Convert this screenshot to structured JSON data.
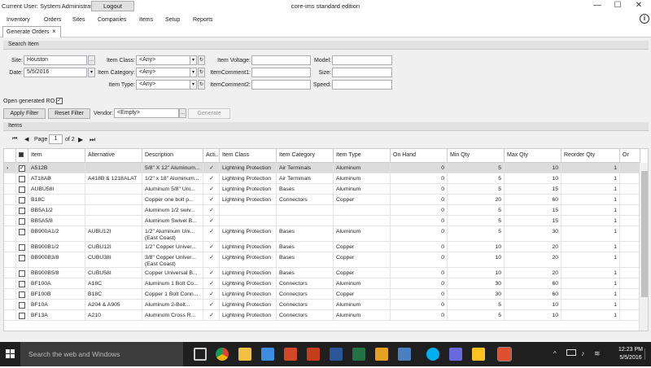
{
  "app": {
    "current_user": "Current User: System Administrator",
    "logout_label": "Logout",
    "title": "core-ims standard edition",
    "minimize": "—",
    "maximize": "☐",
    "close": "✕"
  },
  "menu": [
    "Inventory",
    "Orders",
    "Sites",
    "Companies",
    "Items",
    "Setup",
    "Reports"
  ],
  "info_icon": "i",
  "tab": {
    "label": "Generate Orders",
    "close": "×"
  },
  "search": {
    "header": "Search Item",
    "site_label": "Site:",
    "site_value": "Houston",
    "date_label": "Date:",
    "date_value": "5/5/2016",
    "item_class_label": "Item Class:",
    "item_class_value": "<Any>",
    "item_category_label": "Item Category:",
    "item_category_value": "<Any>",
    "item_type_label": "Item Type:",
    "item_type_value": "<Any>",
    "item_voltage_label": "Item Voltage:",
    "item_comment1_label": "ItemComment1:",
    "item_comment2_label": "ItemComment2:",
    "model_label": "Model:",
    "size_label": "Size:",
    "speed_label": "Speed:",
    "browse_glyph": "...",
    "date_glyph": "▾",
    "dd_glyph": "▾",
    "refresh_glyph": "↻"
  },
  "open_ro": {
    "label": "Open generated RO:",
    "checked": "✓"
  },
  "actions": {
    "apply_filter": "Apply Filter",
    "reset_filter": "Reset Filter",
    "vendor_label": "Vendor:",
    "vendor_value": "<Empty>",
    "generate": "Generate"
  },
  "items": {
    "header": "Items",
    "page_label": "Page",
    "page_value": "1",
    "page_of": "of 2",
    "first_glyph": "⏮",
    "prev_glyph": "◀",
    "next_glyph": "▶",
    "last_glyph": "⏭"
  },
  "table": {
    "columns": [
      "",
      "Item",
      "Alternative",
      "Description",
      "Acti...",
      "Item Class",
      "Item Category",
      "Item Type",
      "On Hand",
      "Min Qty",
      "Max Qty",
      "Reorder Qty",
      "Or"
    ],
    "rows": [
      {
        "check": "✓",
        "item": "A512B",
        "alt": "",
        "desc": "5/8\" X 12\" Aluminum...",
        "active": "✓",
        "class": "Lightning Protection",
        "category": "Air Terminals",
        "type": "Aluminum",
        "on_hand": "0",
        "min": "5",
        "max": "10",
        "reorder": "1"
      },
      {
        "check": "",
        "item": "AT18AB",
        "alt": "A418B & 1218ALAT",
        "desc": "1/2\" x 18\" Aluminum...",
        "active": "✓",
        "class": "Lightning Protection",
        "category": "Air Terminals",
        "type": "Aluminum",
        "on_hand": "0",
        "min": "5",
        "max": "10",
        "reorder": "1"
      },
      {
        "check": "",
        "item": "AUBU58I",
        "alt": "",
        "desc": "Aluminum 5/8\" Uni...",
        "active": "✓",
        "class": "Lightning Protection",
        "category": "Bases",
        "type": "Aluminum",
        "on_hand": "0",
        "min": "5",
        "max": "15",
        "reorder": "1"
      },
      {
        "check": "",
        "item": "B18C",
        "alt": "",
        "desc": "Copper one bolt p...",
        "active": "✓",
        "class": "Lightning Protection",
        "category": "Connectors",
        "type": "Copper",
        "on_hand": "0",
        "min": "20",
        "max": "60",
        "reorder": "1"
      },
      {
        "check": "",
        "item": "BB5A1/2",
        "alt": "",
        "desc": "Aluminum 1/2 swiv...",
        "active": "✓",
        "class": "",
        "category": "",
        "type": "",
        "on_hand": "0",
        "min": "5",
        "max": "15",
        "reorder": "1"
      },
      {
        "check": "",
        "item": "BB5A5/8",
        "alt": "",
        "desc": "Aluminum Swivel B...",
        "active": "✓",
        "class": "",
        "category": "",
        "type": "",
        "on_hand": "0",
        "min": "5",
        "max": "15",
        "reorder": "1"
      },
      {
        "check": "",
        "item": "BB900A1/2",
        "alt": "AUBU12I",
        "desc": "1/2\" Aluminum Uni... (East Coast)",
        "active": "✓",
        "class": "Lightning Protection",
        "category": "Bases",
        "type": "Aluminum",
        "on_hand": "0",
        "min": "5",
        "max": "30",
        "reorder": "1"
      },
      {
        "check": "",
        "item": "BB900B1/2",
        "alt": "CUBU12I",
        "desc": "1/2\" Copper Univer...",
        "active": "✓",
        "class": "Lightning Protection",
        "category": "Bases",
        "type": "Copper",
        "on_hand": "0",
        "min": "10",
        "max": "20",
        "reorder": "1"
      },
      {
        "check": "",
        "item": "BB900B3/8",
        "alt": "CUBU38I",
        "desc": "3/8\" Copper Univer... (East Coast)",
        "active": "✓",
        "class": "Lightning Protection",
        "category": "Bases",
        "type": "Copper",
        "on_hand": "0",
        "min": "10",
        "max": "20",
        "reorder": "1"
      },
      {
        "check": "",
        "item": "BB900B5/8",
        "alt": "CUBU58I",
        "desc": "Copper Universal B...",
        "active": "✓",
        "class": "Lightning Protection",
        "category": "Bases",
        "type": "Copper",
        "on_hand": "0",
        "min": "10",
        "max": "20",
        "reorder": "1"
      },
      {
        "check": "",
        "item": "BF100A",
        "alt": "A18C",
        "desc": "Aluminum 1 Bolt Co...",
        "active": "✓",
        "class": "Lightning Protection",
        "category": "Connectors",
        "type": "Aluminum",
        "on_hand": "0",
        "min": "30",
        "max": "60",
        "reorder": "1"
      },
      {
        "check": "",
        "item": "BF100B",
        "alt": "B18C",
        "desc": "Copper 1 Bolt Conn...",
        "active": "✓",
        "class": "Lightning Protection",
        "category": "Connectors",
        "type": "Copper",
        "on_hand": "0",
        "min": "30",
        "max": "60",
        "reorder": "1"
      },
      {
        "check": "",
        "item": "BF10A",
        "alt": "A204 & A905",
        "desc": "Aluminum 2-Bolt...",
        "active": "✓",
        "class": "Lightning Protection",
        "category": "Connectors",
        "type": "Aluminum",
        "on_hand": "0",
        "min": "5",
        "max": "10",
        "reorder": "1"
      },
      {
        "check": "",
        "item": "BF13A",
        "alt": "A210",
        "desc": "Aluminum Cross R...",
        "active": "✓",
        "class": "Lightning Protection",
        "category": "Connectors",
        "type": "Aluminum",
        "on_hand": "0",
        "min": "5",
        "max": "10",
        "reorder": "1"
      }
    ]
  },
  "taskbar": {
    "search_placeholder": "Search the web and Windows",
    "time": "12:23 PM",
    "date": "5/5/2016",
    "icons": [
      "task-view-icon",
      "chrome-icon",
      "file-explorer-icon",
      "app-icon",
      "powerpoint-icon",
      "word-icon",
      "excel-icon",
      "outlook-icon",
      "app-icon-2",
      "skype-icon",
      "app-icon-3",
      "walmart-icon",
      "app-icon-4"
    ]
  }
}
